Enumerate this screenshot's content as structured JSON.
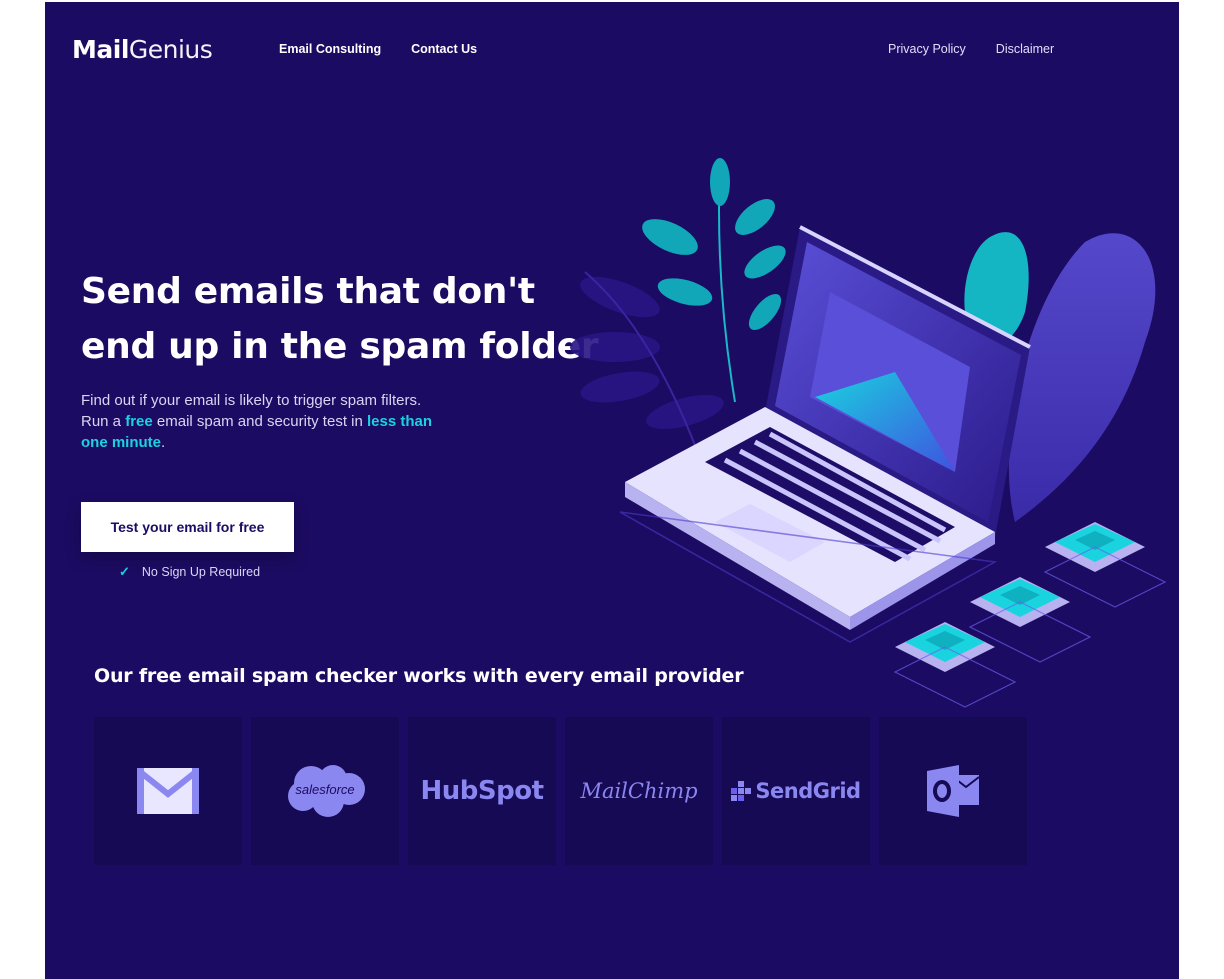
{
  "header": {
    "logo_bold": "Mail",
    "logo_light": "Genius",
    "nav_left": [
      "Email Consulting",
      "Contact Us"
    ],
    "nav_right": [
      "Privacy Policy",
      "Disclaimer"
    ]
  },
  "hero": {
    "title_line1": "Send emails that don't",
    "title_line2": "end up in the spam folder",
    "sub_part1": "Find out if your email is likely to trigger spam filters. Run a ",
    "sub_free": "free",
    "sub_part2": " email spam and security test in ",
    "sub_time": "less than one minute",
    "sub_end": ".",
    "cta_label": "Test your email for free",
    "note": "No Sign Up Required"
  },
  "providers": {
    "title": "Our free email spam checker works with every email provider",
    "items": [
      {
        "name": "Gmail",
        "icon": "gmail-icon"
      },
      {
        "name": "salesforce",
        "icon": "salesforce-logo"
      },
      {
        "name": "HubSpot",
        "icon": "hubspot-logo"
      },
      {
        "name": "MailChimp",
        "icon": "mailchimp-logo"
      },
      {
        "name": "SendGrid",
        "icon": "sendgrid-logo"
      },
      {
        "name": "Outlook",
        "icon": "outlook-icon"
      }
    ]
  },
  "colors": {
    "background": "#1c0b62",
    "accent": "#19d3df",
    "logo_tint": "#8b87f0",
    "card": "#160a55"
  }
}
